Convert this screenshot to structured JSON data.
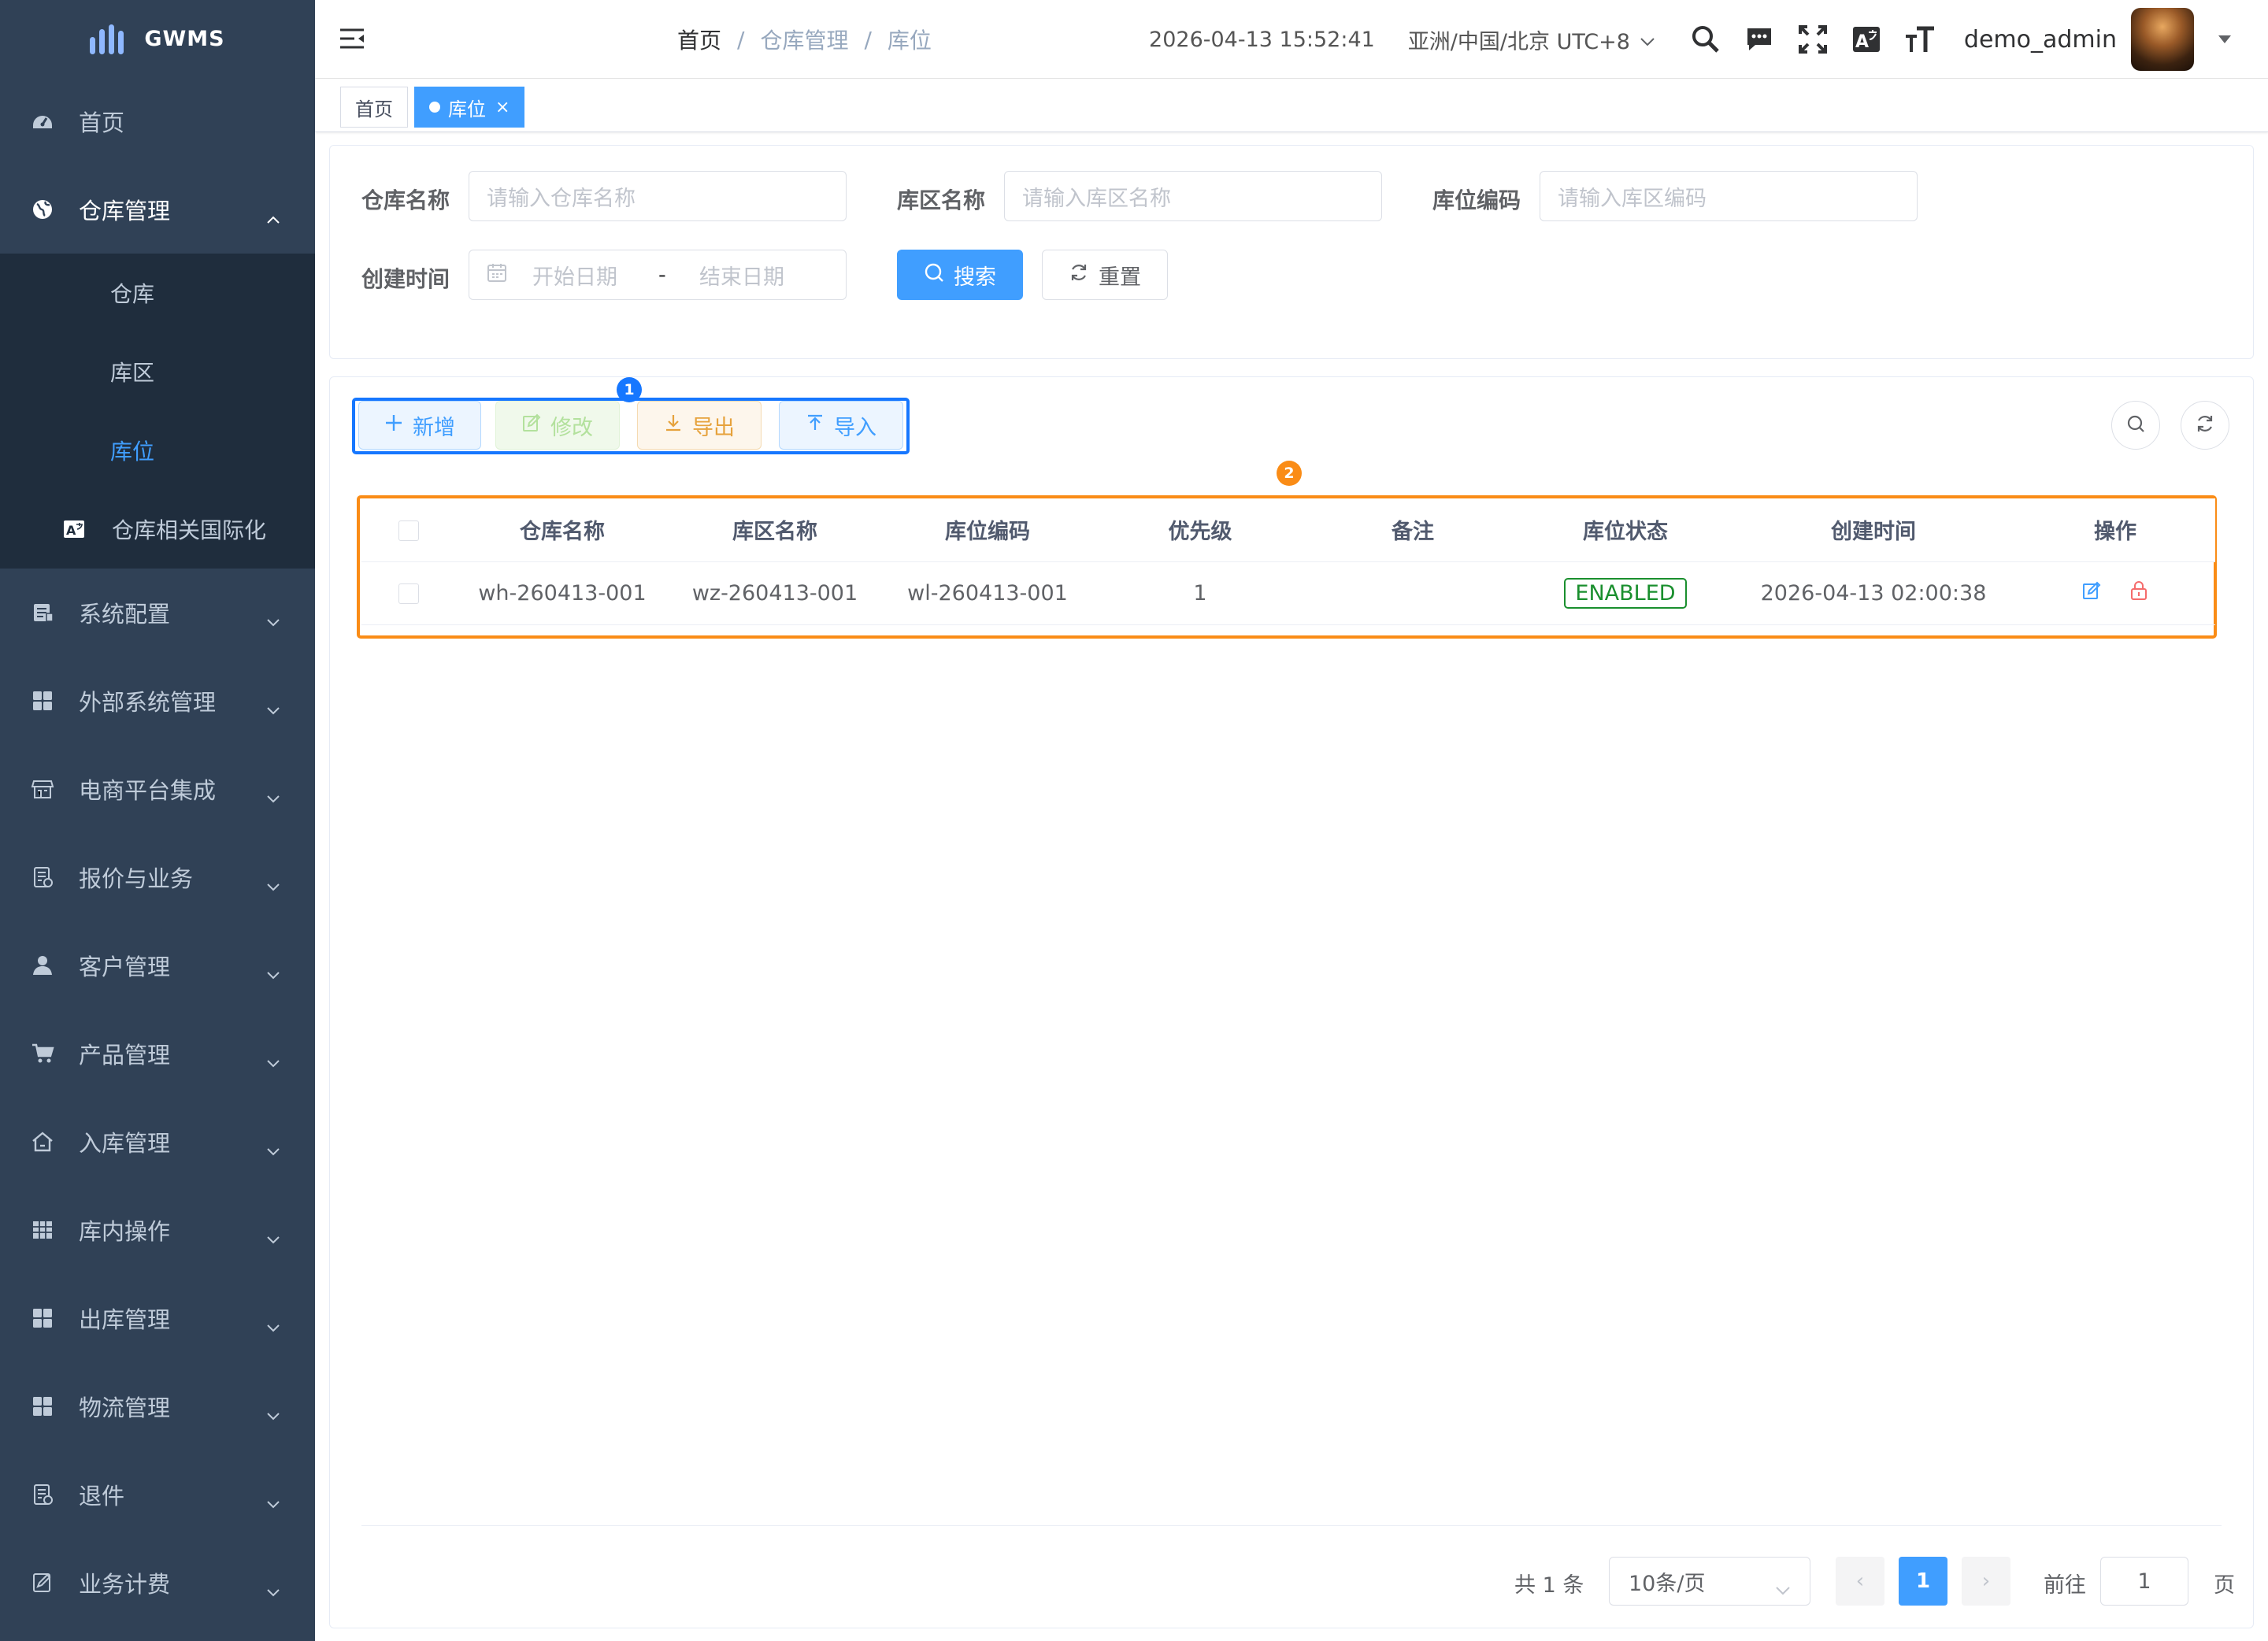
{
  "app": {
    "name": "GWMS"
  },
  "sidebar": {
    "items": [
      {
        "label": "首页",
        "icon": "dashboard-icon"
      },
      {
        "label": "仓库管理",
        "icon": "globe-icon",
        "open": true,
        "children": [
          {
            "label": "仓库"
          },
          {
            "label": "库区"
          },
          {
            "label": "库位",
            "active": true
          },
          {
            "label": "仓库相关国际化",
            "icon": "translate-icon"
          }
        ]
      },
      {
        "label": "系统配置",
        "icon": "server-icon"
      },
      {
        "label": "外部系统管理",
        "icon": "grid-icon"
      },
      {
        "label": "电商平台集成",
        "icon": "store-icon"
      },
      {
        "label": "报价与业务",
        "icon": "doc-icon"
      },
      {
        "label": "客户管理",
        "icon": "user-icon"
      },
      {
        "label": "产品管理",
        "icon": "cart-icon"
      },
      {
        "label": "入库管理",
        "icon": "home-icon"
      },
      {
        "label": "库内操作",
        "icon": "table-icon"
      },
      {
        "label": "出库管理",
        "icon": "grid-icon"
      },
      {
        "label": "物流管理",
        "icon": "grid-icon"
      },
      {
        "label": "退件",
        "icon": "doc-icon"
      },
      {
        "label": "业务计费",
        "icon": "edit-doc-icon"
      }
    ]
  },
  "header": {
    "breadcrumb": [
      "首页",
      "仓库管理",
      "库位"
    ],
    "datetime": "2026-04-13 15:52:41",
    "timezone": "亚洲/中国/北京 UTC+8",
    "username": "demo_admin"
  },
  "tags": [
    {
      "label": "首页"
    },
    {
      "label": "库位",
      "active": true
    }
  ],
  "search": {
    "warehouse_label": "仓库名称",
    "warehouse_placeholder": "请输入仓库名称",
    "zone_label": "库区名称",
    "zone_placeholder": "请输入库区名称",
    "location_label": "库位编码",
    "location_placeholder": "请输入库区编码",
    "created_label": "创建时间",
    "start_placeholder": "开始日期",
    "date_sep": "-",
    "end_placeholder": "结束日期",
    "search_btn": "搜索",
    "reset_btn": "重置"
  },
  "toolbar": {
    "add": "新增",
    "edit": "修改",
    "export": "导出",
    "import": "导入",
    "marker1": "1",
    "marker2": "2"
  },
  "table": {
    "columns": [
      "仓库名称",
      "库区名称",
      "库位编码",
      "优先级",
      "备注",
      "库位状态",
      "创建时间",
      "操作"
    ],
    "rows": [
      {
        "warehouse": "wh-260413-001",
        "zone": "wz-260413-001",
        "code": "wl-260413-001",
        "priority": "1",
        "remark": "",
        "status": "ENABLED",
        "created": "2026-04-13 02:00:38"
      }
    ]
  },
  "pagination": {
    "total": "共 1 条",
    "page_size": "10条/页",
    "current": "1",
    "goto_label": "前往",
    "goto_value": "1",
    "page_suffix": "页"
  },
  "colors": {
    "primary": "#409eff",
    "sidebar": "#304156",
    "annot_blue": "#1677ff",
    "annot_orange": "#fa8c16",
    "enabled": "#1a8f2e"
  }
}
